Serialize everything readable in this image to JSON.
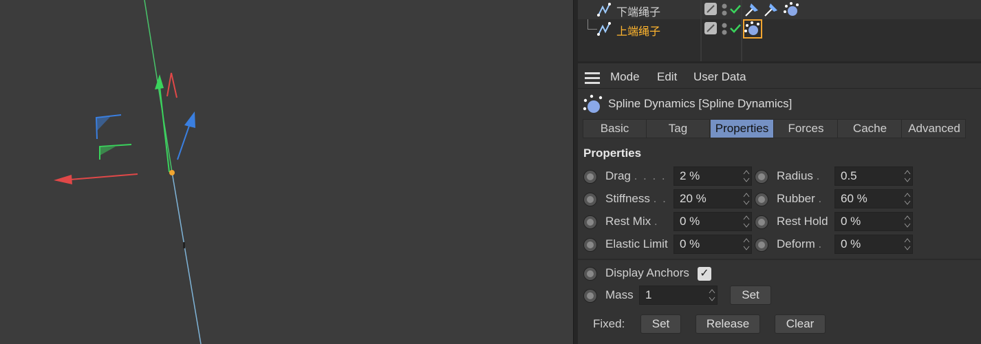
{
  "object_manager": {
    "rows": [
      {
        "name": "下端绳子",
        "active": false
      },
      {
        "name": "上端绳子",
        "active": true
      }
    ],
    "icons": [
      "spline-icon",
      "visibility-toggle-icon",
      "enabled-check-icon",
      "pin-tag-icon",
      "spline-dynamics-tag-icon"
    ]
  },
  "menubar": {
    "items": [
      "Mode",
      "Edit",
      "User Data"
    ]
  },
  "attributes": {
    "title": "Spline Dynamics [Spline Dynamics]",
    "tabs": [
      "Basic",
      "Tag",
      "Properties",
      "Forces",
      "Cache",
      "Advanced"
    ],
    "active_tab": "Properties",
    "group_title": "Properties",
    "params_left": [
      {
        "label": "Drag",
        "dots": ". . . .",
        "value": "2 %"
      },
      {
        "label": "Stiffness",
        "dots": ". .",
        "value": "20 %"
      },
      {
        "label": "Rest Mix",
        "dots": ".",
        "value": "0 %"
      },
      {
        "label": "Elastic Limit",
        "dots": "",
        "value": "0 %"
      }
    ],
    "params_right": [
      {
        "label": "Radius",
        "dots": ".",
        "value": "0.5"
      },
      {
        "label": "Rubber",
        "dots": ".",
        "value": "60 %"
      },
      {
        "label": "Rest Hold",
        "dots": "",
        "value": "0 %"
      },
      {
        "label": "Deform",
        "dots": ".",
        "value": "0 %"
      }
    ],
    "display_anchors_label": "Display Anchors",
    "display_anchors_checked": true,
    "mass_label": "Mass",
    "mass_value": "1",
    "mass_set_button": "Set",
    "fixed_label": "Fixed:",
    "fixed_buttons": [
      "Set",
      "Release",
      "Clear"
    ]
  },
  "colors": {
    "accent_tab": "#7591c4",
    "active_object": "#ffb52e",
    "axis_x": "#e04848",
    "axis_y": "#3ad35c",
    "axis_z": "#3a7fe0"
  }
}
